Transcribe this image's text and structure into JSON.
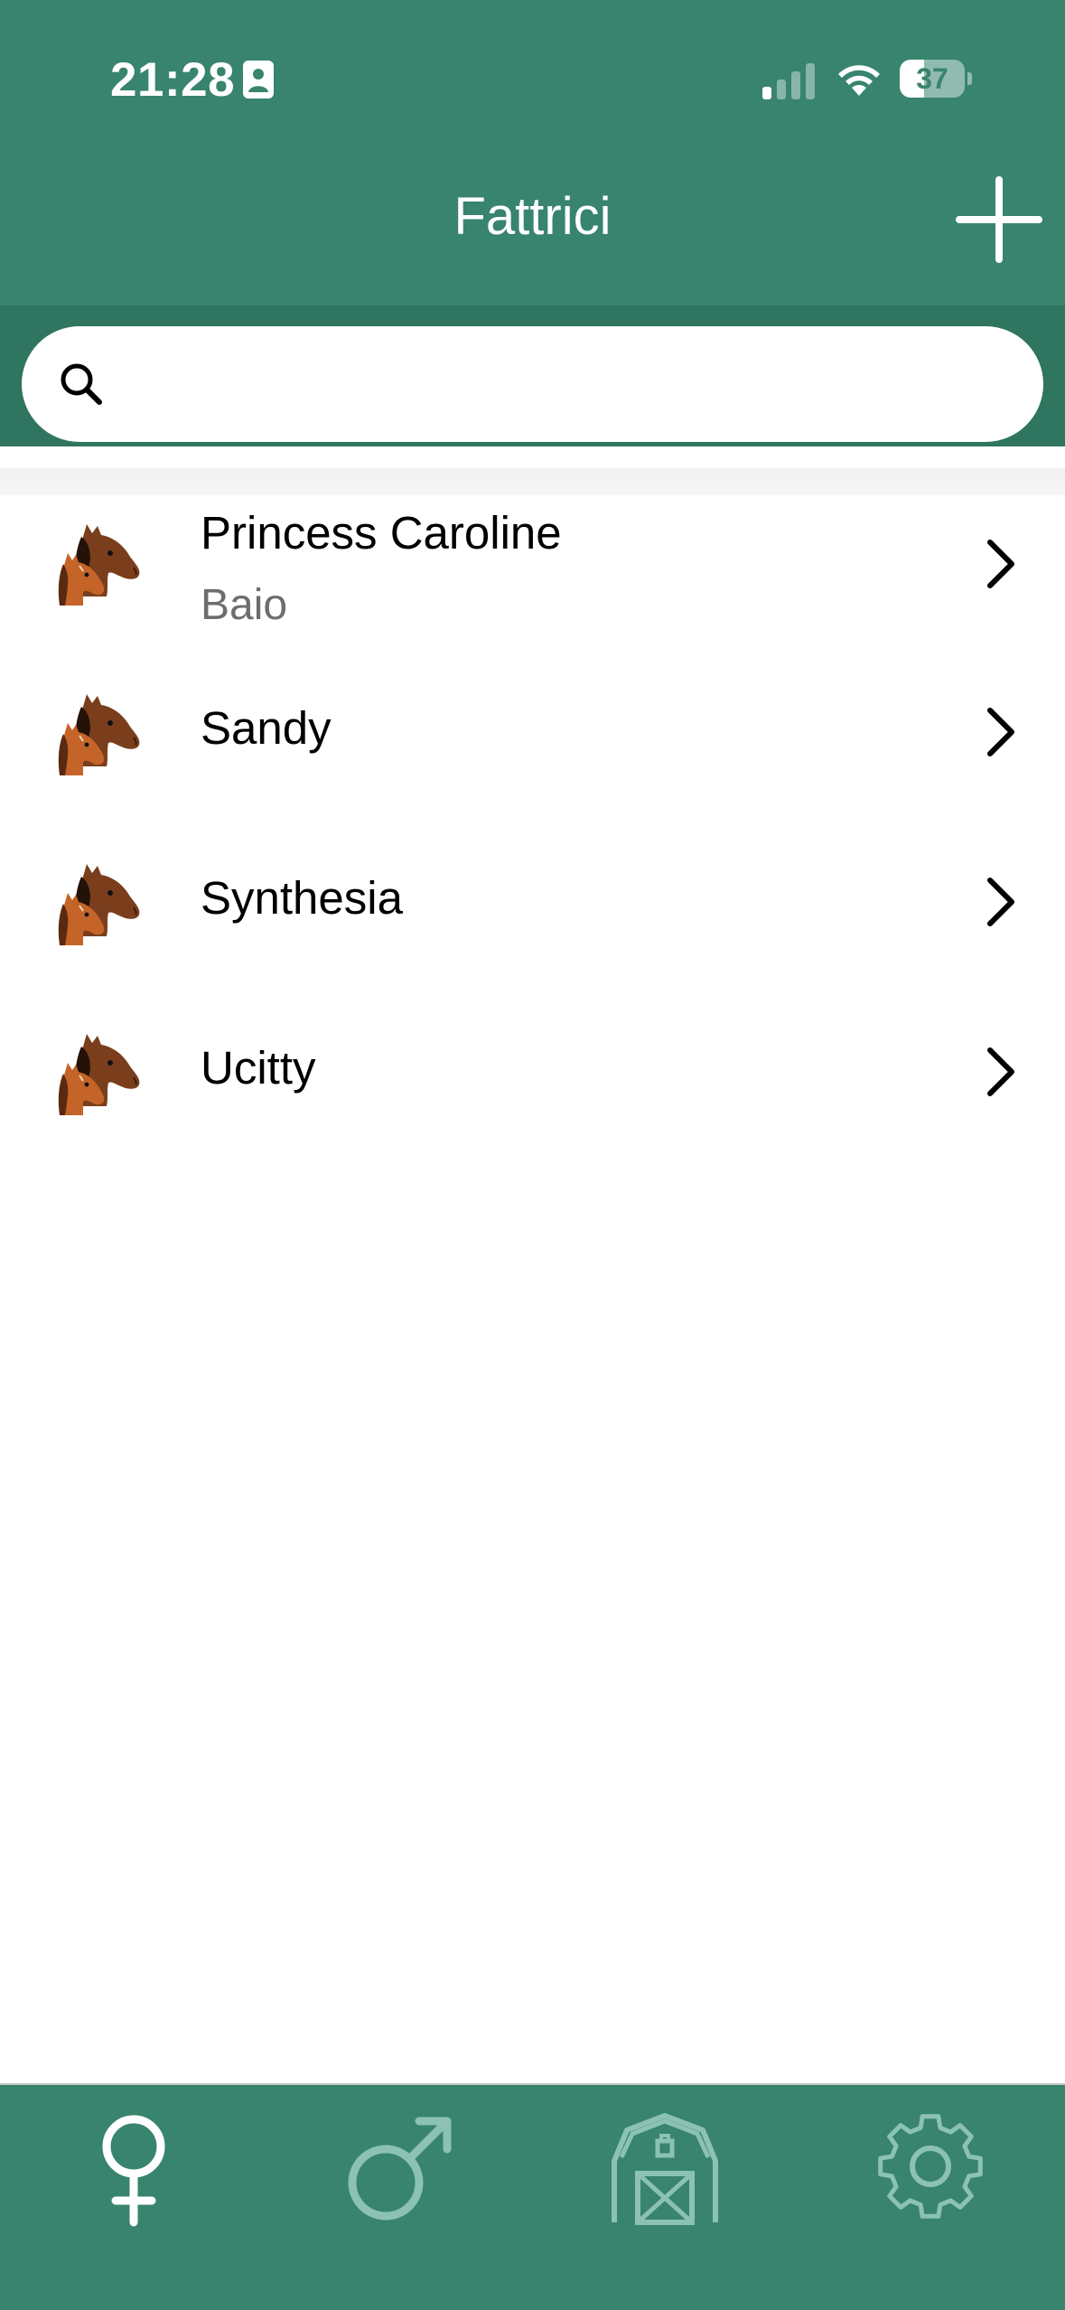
{
  "status_bar": {
    "time": "21:28",
    "battery_percent": "37",
    "battery_level": 0.37
  },
  "header": {
    "title": "Fattrici"
  },
  "search": {
    "placeholder": "",
    "value": ""
  },
  "mares": [
    {
      "name": "Princess Caroline",
      "subtitle": "Baio"
    },
    {
      "name": "Sandy",
      "subtitle": ""
    },
    {
      "name": "Synthesia",
      "subtitle": ""
    },
    {
      "name": "Ucitty",
      "subtitle": ""
    }
  ],
  "tab_bar": {
    "tabs": [
      {
        "icon": "female-symbol-icon",
        "selected": true
      },
      {
        "icon": "male-symbol-icon",
        "selected": false
      },
      {
        "icon": "barn-icon",
        "selected": false
      },
      {
        "icon": "gear-icon",
        "selected": false
      }
    ]
  },
  "colors": {
    "header": "#38846e",
    "search_band": "#2f7560",
    "tab_active": "#ffffff",
    "tab_inactive": "#8cc2b2"
  }
}
